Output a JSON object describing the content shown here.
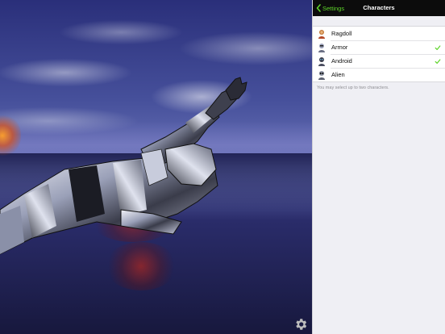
{
  "navbar": {
    "back_label": "Settings",
    "title": "Characters"
  },
  "characters": [
    {
      "label": "Ragdoll",
      "icon": "ragdoll-icon",
      "selected": false
    },
    {
      "label": "Armor",
      "icon": "armor-icon",
      "selected": true
    },
    {
      "label": "Android",
      "icon": "android-icon",
      "selected": true
    },
    {
      "label": "Alien",
      "icon": "alien-icon",
      "selected": false
    }
  ],
  "footnote": "You may select up to two characters.",
  "colors": {
    "accent": "#5ed42a",
    "navbar": "#0c0c0c",
    "panel_bg": "#efeff4"
  },
  "scene": {
    "settings_icon": "gear-icon"
  }
}
